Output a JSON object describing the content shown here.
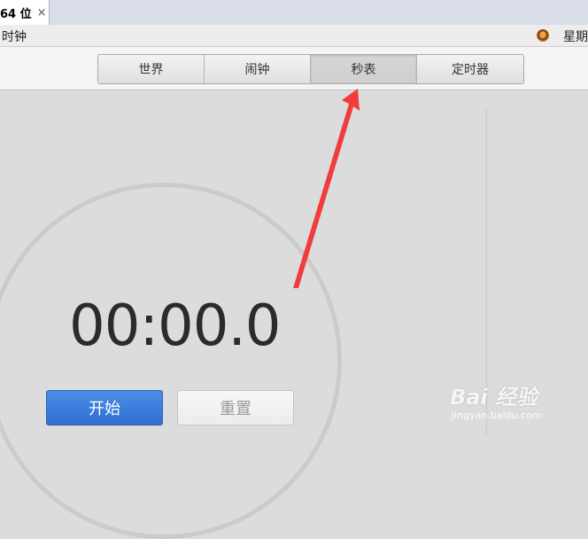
{
  "vm_tab": {
    "label": "64 位",
    "close": "×"
  },
  "topbar": {
    "app_name": "时钟",
    "clock": "星期"
  },
  "tabs": [
    {
      "label": "世界"
    },
    {
      "label": "闹钟"
    },
    {
      "label": "秒表",
      "active": true
    },
    {
      "label": "定时器"
    }
  ],
  "stopwatch": {
    "time": "00:00.0",
    "start_label": "开始",
    "reset_label": "重置"
  },
  "annotation": {
    "color": "#f03c3c"
  },
  "watermark": {
    "brand": "Bai 经验",
    "site": "jingyan.baidu.com"
  },
  "colors": {
    "accent": "#3a7bdc",
    "arrow": "#f03c3c"
  }
}
